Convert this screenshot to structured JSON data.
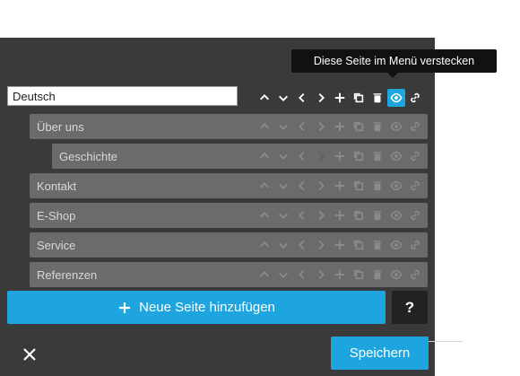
{
  "tooltip": {
    "text": "Diese Seite im Menü verstecken"
  },
  "root": {
    "value": "Deutsch",
    "controls": [
      "chevron-up-icon",
      "chevron-down-icon",
      "chevron-left-icon",
      "chevron-right-icon",
      "plus-icon",
      "copy-icon",
      "trash-icon",
      "eye-icon",
      "link-icon"
    ],
    "active_control": "eye-icon"
  },
  "pages": [
    {
      "label": "Über uns",
      "level": 1
    },
    {
      "label": "Geschichte",
      "level": 2
    },
    {
      "label": "Kontakt",
      "level": 1
    },
    {
      "label": "E-Shop",
      "level": 1
    },
    {
      "label": "Service",
      "level": 1
    },
    {
      "label": "Referenzen",
      "level": 1
    }
  ],
  "footer": {
    "add_label": "Neue Seite hinzufügen",
    "help_label": "?",
    "save_label": "Speichern"
  },
  "colors": {
    "accent": "#1ea5e0",
    "panel": "#3a3a3a",
    "row": "#6b6b6b"
  }
}
